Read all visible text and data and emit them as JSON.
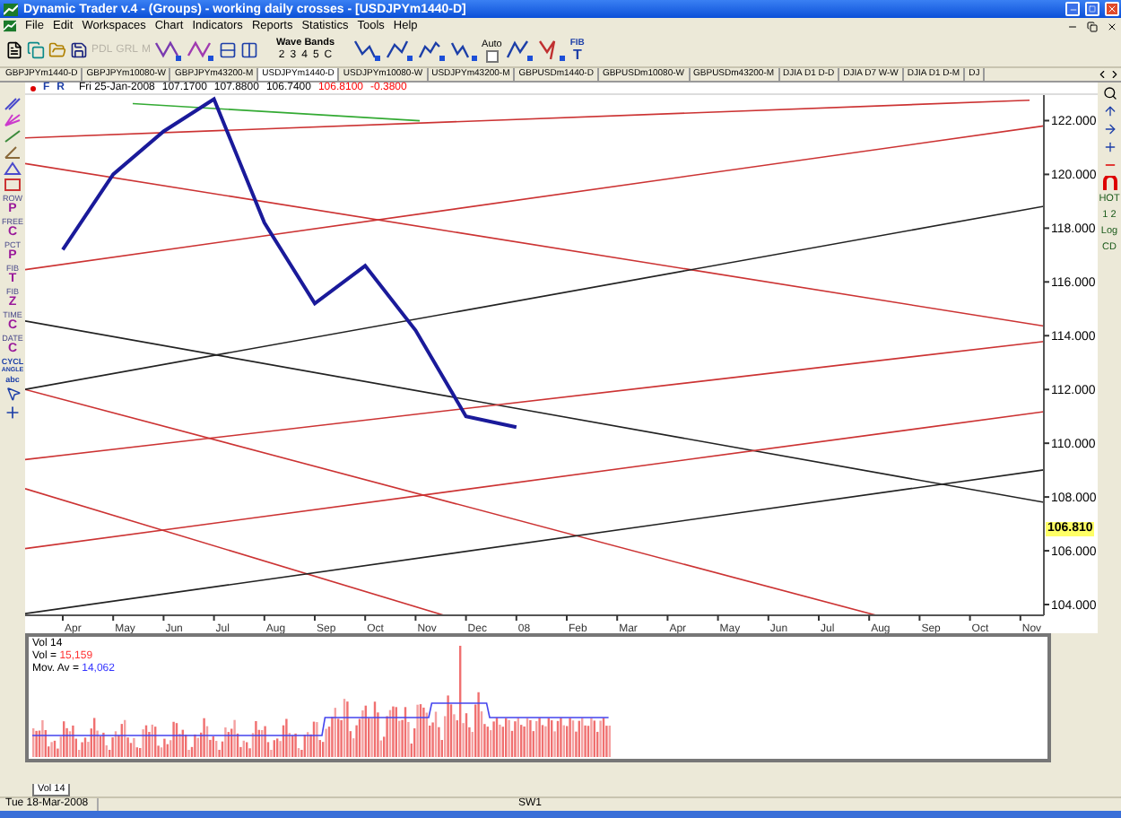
{
  "window": {
    "title": "Dynamic Trader v.4 - (Groups) - working daily crosses - [USDJPYm1440-D]"
  },
  "menu": [
    "File",
    "Edit",
    "Workspaces",
    "Chart",
    "Indicators",
    "Reports",
    "Statistics",
    "Tools",
    "Help"
  ],
  "toolbar": {
    "disabled_buttons": [
      {
        "label": "PDL",
        "disabled": true
      },
      {
        "label": "GRL",
        "disabled": true
      },
      {
        "label": "M",
        "disabled": true
      }
    ],
    "wave_bands": {
      "label": "Wave Bands",
      "buttons": [
        "2",
        "3",
        "4",
        "5",
        "C"
      ]
    },
    "auto": {
      "label": "Auto",
      "checked": false
    },
    "fib_tool": {
      "top": "FIB",
      "bottom": "T"
    }
  },
  "tabs": [
    {
      "label": "GBPJPYm1440-D",
      "selected": false
    },
    {
      "label": "GBPJPYm10080-W",
      "selected": false
    },
    {
      "label": "GBPJPYm43200-M",
      "selected": false
    },
    {
      "label": "USDJPYm1440-D",
      "selected": true
    },
    {
      "label": "USDJPYm10080-W",
      "selected": false
    },
    {
      "label": "USDJPYm43200-M",
      "selected": false
    },
    {
      "label": "GBPUSDm1440-D",
      "selected": false
    },
    {
      "label": "GBPUSDm10080-W",
      "selected": false
    },
    {
      "label": "GBPUSDm43200-M",
      "selected": false
    },
    {
      "label": "DJIA  D1 D-D",
      "selected": false
    },
    {
      "label": "DJIA  D7 W-W",
      "selected": false
    },
    {
      "label": "DJIA  D1 D-M",
      "selected": false
    },
    {
      "label": "DJ",
      "selected": false
    }
  ],
  "left_tools": [
    {
      "kind": "letter",
      "top": "ROW",
      "bottom": "P"
    },
    {
      "kind": "letter",
      "top": "FREE",
      "bottom": "C"
    },
    {
      "kind": "letter",
      "top": "PCT",
      "bottom": "P"
    },
    {
      "kind": "letter",
      "top": "FIB",
      "bottom": "T"
    },
    {
      "kind": "letter",
      "top": "FIB",
      "bottom": "Z"
    },
    {
      "kind": "letter",
      "top": "TIME",
      "bottom": "C"
    },
    {
      "kind": "letter",
      "top": "DATE",
      "bottom": "C"
    },
    {
      "kind": "label",
      "top": "CYCL",
      "bottom": "ANGLE"
    },
    {
      "kind": "label",
      "top": "abc"
    }
  ],
  "right_tools": [
    "HOT",
    "1 2",
    "Log",
    "CD"
  ],
  "chart_header": {
    "flags": [
      "F",
      "R"
    ],
    "date": "Fri 25-Jan-2008",
    "values": [
      {
        "text": "107.1700",
        "color": "#000000"
      },
      {
        "text": "107.8800",
        "color": "#000000"
      },
      {
        "text": "106.7400",
        "color": "#000000"
      },
      {
        "text": "106.8100",
        "color": "#ff0000"
      },
      {
        "text": "-0.3800",
        "color": "#ff0000"
      }
    ]
  },
  "price_chart": {
    "current_price": "106.810",
    "chart_data": {
      "type": "line",
      "categories": [
        "Apr",
        "May",
        "Jun",
        "Jul",
        "Aug",
        "Sep",
        "Oct",
        "Nov",
        "Dec",
        "08",
        "Feb",
        "Mar",
        "Apr",
        "May",
        "Jun",
        "Jul",
        "Aug",
        "Sep",
        "Oct",
        "Nov"
      ],
      "series": [
        {
          "color": "#1a1a9a",
          "values": [
            117.2,
            120.0,
            121.6,
            122.8,
            118.2,
            115.2,
            116.6,
            114.2,
            111.0,
            110.6,
            null,
            null,
            null,
            null,
            null,
            null,
            null,
            null,
            null,
            null
          ]
        }
      ],
      "ylim": [
        103.6,
        122.95
      ],
      "yticks": [
        {
          "value": 104,
          "label": "104.000"
        },
        {
          "value": 106,
          "label": "106.000"
        },
        {
          "value": 108,
          "label": "108.000"
        },
        {
          "value": 110,
          "label": "110.000"
        },
        {
          "value": 112,
          "label": "112.000"
        },
        {
          "value": 114,
          "label": "114.000"
        },
        {
          "value": 116,
          "label": "116.000"
        },
        {
          "value": 118,
          "label": "118.000"
        },
        {
          "value": 120,
          "label": "120.000"
        },
        {
          "value": 122,
          "label": "122.000"
        }
      ]
    }
  },
  "volume_panel": {
    "title": "Vol 14",
    "lines": [
      {
        "label": "Vol = ",
        "value": "15,159",
        "color": "#ff3333"
      },
      {
        "label": "Mov. Av = ",
        "value": "14,062",
        "color": "#3333ff"
      }
    ],
    "tab": "Vol 14"
  },
  "status_bar": {
    "date": "Tue 18-Mar-2008",
    "workspace": "SW1"
  }
}
